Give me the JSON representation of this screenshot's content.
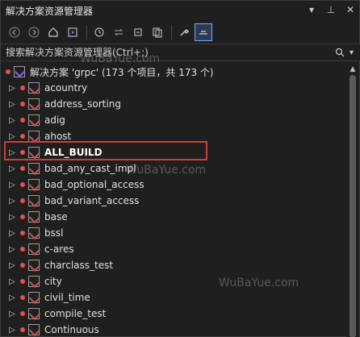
{
  "window": {
    "title": "解决方案资源管理器",
    "title_actions": [
      "▾",
      "⊥",
      "✕"
    ]
  },
  "toolbar": {
    "icons": [
      "back-icon",
      "forward-icon",
      "home-icon",
      "switch-views-icon",
      "pending-changes-filter-icon",
      "sync-icon",
      "collapse-all-icon",
      "show-all-files-icon",
      "properties-icon",
      "preview-selected-icon"
    ]
  },
  "search": {
    "placeholder": "搜索解决方案资源管理器(Ctrl+;)"
  },
  "tree": {
    "solution": "解决方案 'grpc' (173 个项目，共 173 个)",
    "projects": [
      "acountry",
      "address_sorting",
      "adig",
      "ahost",
      "ALL_BUILD",
      "bad_any_cast_impl",
      "bad_optional_access",
      "bad_variant_access",
      "base",
      "bssl",
      "c-ares",
      "charclass_test",
      "city",
      "civil_time",
      "compile_test",
      "Continuous"
    ],
    "selected_project": "ALL_BUILD"
  },
  "watermarks": [
    "WuBaYue.com",
    "WuBaYue.com",
    "WuBaYue.com"
  ],
  "colors": {
    "highlight": "#d23b3b",
    "background": "#1f1f1f"
  }
}
